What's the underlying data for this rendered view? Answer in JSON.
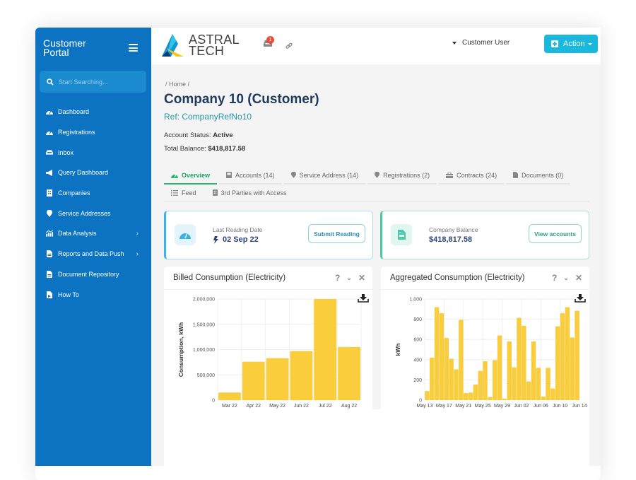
{
  "sidebar": {
    "title_line1": "Customer",
    "title_line2": "Portal",
    "menu_icon": "hamburger-icon",
    "search_placeholder": "Start Searching...",
    "items": [
      {
        "label": "Dashboard",
        "icon": "tachometer-icon"
      },
      {
        "label": "Registrations",
        "icon": "tachometer-icon"
      },
      {
        "label": "Inbox",
        "icon": "inbox-icon"
      },
      {
        "label": "Query Dashboard",
        "icon": "megaphone-icon"
      },
      {
        "label": "Companies",
        "icon": "building-icon"
      },
      {
        "label": "Service Addresses",
        "icon": "map-marker-icon"
      },
      {
        "label": "Data Analysis",
        "icon": "chart-icon",
        "has_submenu": true
      },
      {
        "label": "Reports and Data Push",
        "icon": "file-icon",
        "has_submenu": true
      },
      {
        "label": "Document Repository",
        "icon": "file-icon"
      },
      {
        "label": "How To",
        "icon": "file-video-icon"
      }
    ]
  },
  "header": {
    "logo_line1": "ASTRAL",
    "logo_line2": "TECH",
    "notification_count": "1",
    "user_name": "Customer User",
    "action_label": "Action"
  },
  "page": {
    "breadcrumb": "/ Home /",
    "title": "Company 10 (Customer)",
    "ref": "Ref: CompanyRefNo10",
    "status_label": "Account Status:",
    "status_value": "Active",
    "balance_label": "Total Balance:",
    "balance_value": "$418,817.58"
  },
  "tabs": [
    {
      "label": "Overview",
      "icon": "tachometer-icon",
      "active": true
    },
    {
      "label": "Accounts (14)",
      "icon": "book-icon"
    },
    {
      "label": "Service Address (14)",
      "icon": "map-marker-icon"
    },
    {
      "label": "Registrations (2)",
      "icon": "map-marker-icon"
    },
    {
      "label": "Contracts (24)",
      "icon": "briefcase-icon"
    },
    {
      "label": "Documents (0)",
      "icon": "file-icon"
    },
    {
      "label": "Feed",
      "icon": "list-icon"
    },
    {
      "label": "3rd Parties with Access",
      "icon": "building-icon"
    }
  ],
  "cards": {
    "reading": {
      "label": "Last Reading Date",
      "value": "02 Sep 22",
      "button": "Submit Reading",
      "accent": "#38b5e6"
    },
    "balance": {
      "label": "Company Balance",
      "value": "$418,817.58",
      "button": "View accounts",
      "accent": "#48c6a5"
    }
  },
  "chart_data": [
    {
      "type": "bar",
      "title": "Billed Consumption (Electricity)",
      "xlabel": "",
      "ylabel": "Consumption, kWh",
      "ylim": [
        0,
        2000000
      ],
      "yticks": [
        "0",
        "500,000",
        "1,000,000",
        "1,500,000",
        "2,000,000"
      ],
      "grid": true,
      "color": "#f9cd3c",
      "categories": [
        "Mar 22",
        "Apr 22",
        "May 22",
        "Jun 22",
        "Jul 22",
        "Aug 22"
      ],
      "values": [
        150000,
        760000,
        830000,
        970000,
        2000000,
        1050000
      ]
    },
    {
      "type": "bar",
      "title": "Aggregated Consumption (Electricity)",
      "xlabel": "",
      "ylabel": "kWh",
      "ylim": [
        0,
        1000
      ],
      "yticks": [
        "0",
        "200",
        "400",
        "600",
        "800",
        "1,000"
      ],
      "grid": true,
      "color": "#f9cd3c",
      "xtick_labels": [
        "May 13",
        "May 17",
        "May 21",
        "May 25",
        "May 29",
        "Jun 02",
        "Jun 06",
        "Jun 10",
        "Jun 14"
      ],
      "values": [
        90,
        420,
        920,
        860,
        615,
        410,
        305,
        795,
        70,
        75,
        155,
        290,
        385,
        30,
        395,
        640,
        15,
        580,
        325,
        815,
        735,
        185,
        580,
        320,
        35,
        320,
        115,
        730,
        860,
        920,
        620,
        885
      ]
    }
  ]
}
